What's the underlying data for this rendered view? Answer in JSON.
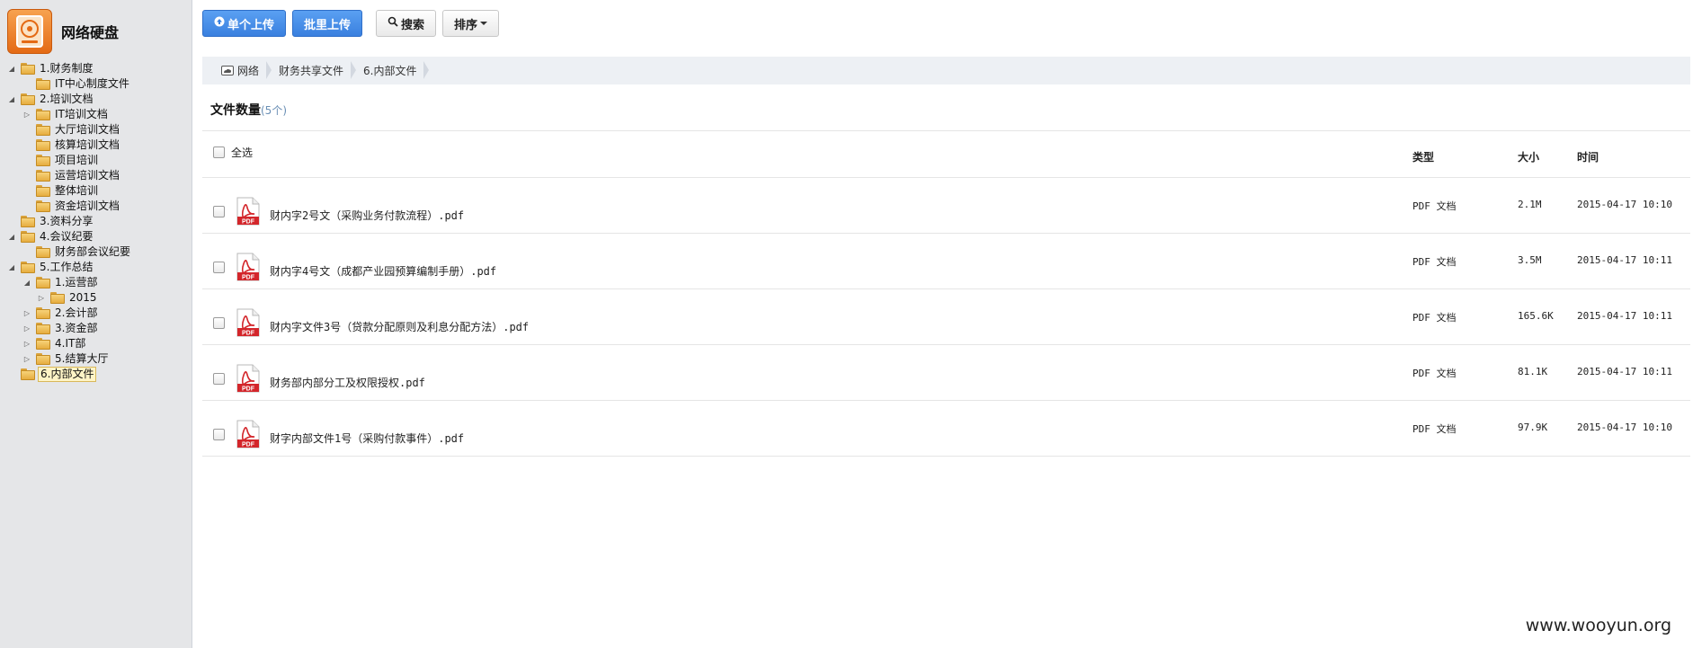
{
  "app": {
    "title": "网络硬盘"
  },
  "tree": [
    {
      "label": "1.财务制度",
      "toggle": "◢",
      "level": 0
    },
    {
      "label": "IT中心制度文件",
      "toggle": "",
      "level": 1
    },
    {
      "label": "2.培训文档",
      "toggle": "◢",
      "level": 0
    },
    {
      "label": "IT培训文档",
      "toggle": "▷",
      "level": 1
    },
    {
      "label": "大厅培训文档",
      "toggle": "",
      "level": 1
    },
    {
      "label": "核算培训文档",
      "toggle": "",
      "level": 1
    },
    {
      "label": "项目培训",
      "toggle": "",
      "level": 1
    },
    {
      "label": "运营培训文档",
      "toggle": "",
      "level": 1
    },
    {
      "label": "整体培训",
      "toggle": "",
      "level": 1
    },
    {
      "label": "资金培训文档",
      "toggle": "",
      "level": 1
    },
    {
      "label": "3.资料分享",
      "toggle": "",
      "level": 0
    },
    {
      "label": "4.会议纪要",
      "toggle": "◢",
      "level": 0
    },
    {
      "label": "财务部会议纪要",
      "toggle": "",
      "level": 1
    },
    {
      "label": "5.工作总结",
      "toggle": "◢",
      "level": 0
    },
    {
      "label": "1.运营部",
      "toggle": "◢",
      "level": 1
    },
    {
      "label": "2015",
      "toggle": "▷",
      "level": 2
    },
    {
      "label": "2.会计部",
      "toggle": "▷",
      "level": 1
    },
    {
      "label": "3.资金部",
      "toggle": "▷",
      "level": 1
    },
    {
      "label": "4.IT部",
      "toggle": "▷",
      "level": 1
    },
    {
      "label": "5.结算大厅",
      "toggle": "▷",
      "level": 1
    },
    {
      "label": "6.内部文件",
      "toggle": "",
      "level": 0,
      "selected": true
    }
  ],
  "toolbar": {
    "single_upload": "单个上传",
    "batch_upload": "批里上传",
    "search": "搜索",
    "sort": "排序"
  },
  "breadcrumb": [
    "网络",
    "财务共享文件",
    "6.内部文件"
  ],
  "count": {
    "label": "文件数量",
    "value": "(5个)"
  },
  "table": {
    "select_all": "全选",
    "col_type": "类型",
    "col_size": "大小",
    "col_time": "时间"
  },
  "files": [
    {
      "name": "财内字2号文（采购业务付款流程）.pdf",
      "type": "PDF 文档",
      "size": "2.1M",
      "time": "2015-04-17 10:10"
    },
    {
      "name": "财内字4号文（成都产业园预算编制手册）.pdf",
      "type": "PDF 文档",
      "size": "3.5M",
      "time": "2015-04-17 10:11"
    },
    {
      "name": "财内字文件3号（贷款分配原则及利息分配方法）.pdf",
      "type": "PDF 文档",
      "size": "165.6K",
      "time": "2015-04-17 10:11"
    },
    {
      "name": "财务部内部分工及权限授权.pdf",
      "type": "PDF 文档",
      "size": "81.1K",
      "time": "2015-04-17 10:11"
    },
    {
      "name": "财字内部文件1号（采购付款事件）.pdf",
      "type": "PDF 文档",
      "size": "97.9K",
      "time": "2015-04-17 10:10"
    }
  ],
  "watermark": "www.wooyun.org",
  "colors": {
    "primary_button": "#3a80df",
    "sidebar_bg": "#e5e6e8",
    "breadcrumb_bg": "#edf0f4"
  }
}
